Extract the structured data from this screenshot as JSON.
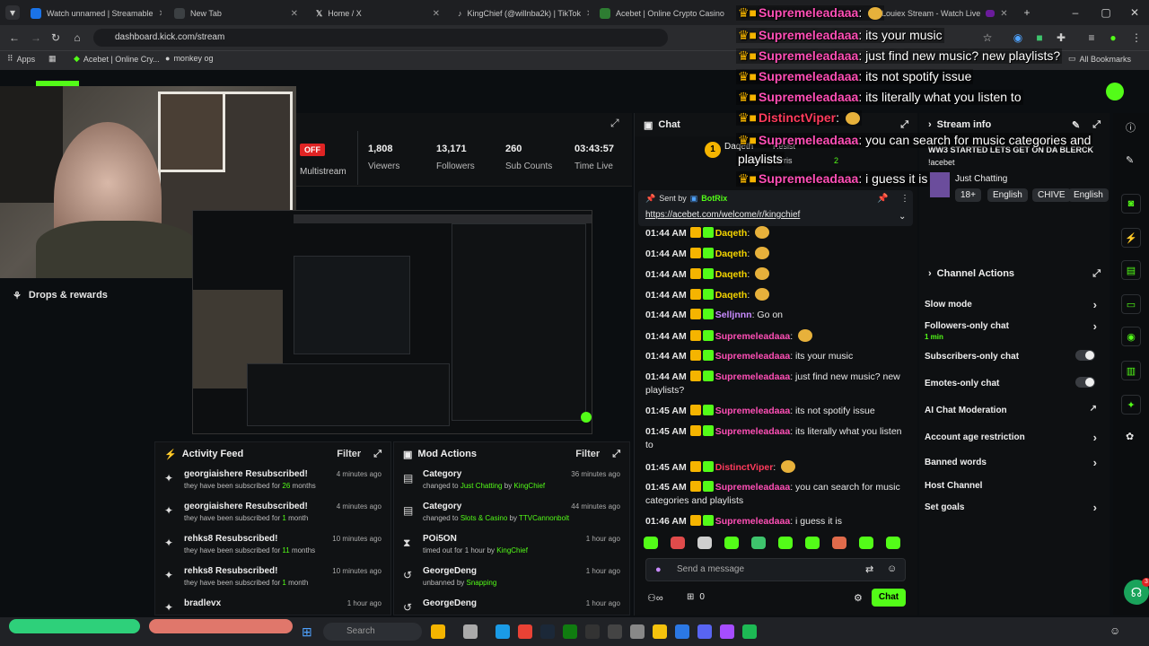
{
  "browser": {
    "tabs": [
      {
        "label": "Watch unnamed | Streamable",
        "color": "#1a73e8"
      },
      {
        "label": "New Tab",
        "color": "#3c4043"
      },
      {
        "label": "Home / X",
        "color": "#000000"
      },
      {
        "label": "KingChief (@willnba2k) | TikTok",
        "color": "#111111"
      },
      {
        "label": "Acebet | Online Crypto Casino",
        "color": "#2e7d32"
      },
      {
        "label": "Louiex Stream - Watch Live",
        "color": "#6a1b9a"
      }
    ],
    "url": "dashboard.kick.com/stream",
    "bookmarks": [
      "Apps",
      "Acebet | Online Cry...",
      "monkey og"
    ],
    "all_bookmarks": "All Bookmarks"
  },
  "left": {
    "drops_label": "Drops & rewards"
  },
  "stats": {
    "status": "OFF",
    "multistream": "Multistream",
    "items": [
      {
        "value": "1,808",
        "label": "Viewers"
      },
      {
        "value": "13,171",
        "label": "Followers"
      },
      {
        "value": "260",
        "label": "Sub Counts"
      },
      {
        "value": "03:43:57",
        "label": "Time Live"
      }
    ]
  },
  "activity": {
    "title": "Activity Feed",
    "filter": "Filter",
    "items": [
      {
        "name": "georgiaishere Resubscribed!",
        "pre": "they have been subscribed for ",
        "hl": "26",
        "post": " months",
        "time": "4 minutes ago"
      },
      {
        "name": "georgiaishere Resubscribed!",
        "pre": "they have been subscribed for ",
        "hl": "1",
        "post": " month",
        "time": "4 minutes ago"
      },
      {
        "name": "rehks8 Resubscribed!",
        "pre": "they have been subscribed for ",
        "hl": "11",
        "post": " months",
        "time": "10 minutes ago"
      },
      {
        "name": "rehks8 Resubscribed!",
        "pre": "they have been subscribed for ",
        "hl": "1",
        "post": " month",
        "time": "10 minutes ago"
      },
      {
        "name": "bradlevx",
        "pre": "",
        "hl": "",
        "post": "",
        "time": "1 hour ago"
      }
    ]
  },
  "mod": {
    "title": "Mod Actions",
    "filter": "Filter",
    "items": [
      {
        "name": "Category",
        "pre": "changed to ",
        "hl": "Just Chatting",
        "mid": " by ",
        "hl2": "KingChief",
        "time": "36 minutes ago"
      },
      {
        "name": "Category",
        "pre": "changed to ",
        "hl": "Slots & Casino",
        "mid": " by ",
        "hl2": "TTVCannonbolt",
        "time": "44 minutes ago"
      },
      {
        "name": "POi5ON",
        "pre": "timed out for 1 hour by ",
        "hl": "",
        "mid": "",
        "hl2": "KingChief",
        "time": "1 hour ago"
      },
      {
        "name": "GeorgeDeng",
        "pre": "unbanned by ",
        "hl": "",
        "mid": "",
        "hl2": "Snapping",
        "time": "1 hour ago"
      },
      {
        "name": "GeorgeDeng",
        "pre": "",
        "hl": "",
        "mid": "",
        "hl2": "",
        "time": "1 hour ago"
      }
    ]
  },
  "chat": {
    "title": "Chat",
    "pinned_by_prefix": "Sent by",
    "pinned_by": "BotRix",
    "pinned_link": "https://acebet.com/welcome/r/kingchief",
    "top_user": "Daqeth",
    "top_user2": "MathewHarris",
    "top_count": "2",
    "resist": "Resist",
    "messages": [
      {
        "time": "01:44 AM",
        "user": "Daqeth",
        "color": "#f5d400",
        "text": ""
      },
      {
        "time": "01:44 AM",
        "user": "Daqeth",
        "color": "#f5d400",
        "text": ""
      },
      {
        "time": "01:44 AM",
        "user": "Daqeth",
        "color": "#f5d400",
        "text": ""
      },
      {
        "time": "01:44 AM",
        "user": "Daqeth",
        "color": "#f5d400",
        "text": ""
      },
      {
        "time": "01:44 AM",
        "user": "Selljnnn",
        "color": "#c98bff",
        "text": "Go on"
      },
      {
        "time": "01:44 AM",
        "user": "Supremeleadaaa",
        "color": "#ff4fb6",
        "text": ""
      },
      {
        "time": "01:44 AM",
        "user": "Supremeleadaaa",
        "color": "#ff4fb6",
        "text": "its your music"
      },
      {
        "time": "01:44 AM",
        "user": "Supremeleadaaa",
        "color": "#ff4fb6",
        "text": "just find new music? new playlists?"
      },
      {
        "time": "01:45 AM",
        "user": "Supremeleadaaa",
        "color": "#ff4fb6",
        "text": "its not spotify issue"
      },
      {
        "time": "01:45 AM",
        "user": "Supremeleadaaa",
        "color": "#ff4fb6",
        "text": "its literally what you listen to"
      },
      {
        "time": "01:45 AM",
        "user": "DistinctViper",
        "color": "#ff3b5c",
        "text": ""
      },
      {
        "time": "01:45 AM",
        "user": "Supremeleadaaa",
        "color": "#ff4fb6",
        "text": "you can search for music categories and playlists"
      },
      {
        "time": "01:46 AM",
        "user": "Supremeleadaaa",
        "color": "#ff4fb6",
        "text": "i guess it is"
      }
    ],
    "input_placeholder": "Send a message",
    "footer_count": "0",
    "send_label": "Chat"
  },
  "overlay": {
    "lines": [
      {
        "user": "Supremeleadaaa",
        "text": ""
      },
      {
        "user": "Supremeleadaaa",
        "text": "its your music"
      },
      {
        "user": "Supremeleadaaa",
        "text": "just find new music? new playlists?"
      },
      {
        "user": "Supremeleadaaa",
        "text": "its not spotify issue"
      },
      {
        "user": "Supremeleadaaa",
        "text": "its literally what you listen to"
      },
      {
        "user": "DistinctViper",
        "text": ""
      },
      {
        "user": "Supremeleadaaa",
        "text": "you can search for music categories and"
      },
      {
        "user": "",
        "text": "playlists"
      },
      {
        "user": "Supremeleadaaa",
        "text": "i guess it is"
      }
    ]
  },
  "stream_info": {
    "title": "Stream info",
    "stream_title": "WW3 STARTED LETS GET ON DA BLERCK",
    "sub": "!acebet",
    "category": "Just Chatting",
    "tags": [
      "18+",
      "English",
      "CHIVE",
      "English"
    ]
  },
  "channel_actions": {
    "title": "Channel Actions",
    "items": [
      {
        "label": "Slow mode",
        "type": "chev",
        "sub": ""
      },
      {
        "label": "Followers-only chat",
        "type": "chev",
        "sub": "1 min"
      },
      {
        "label": "Subscribers-only chat",
        "type": "toggle",
        "sub": ""
      },
      {
        "label": "Emotes-only chat",
        "type": "toggle",
        "sub": ""
      },
      {
        "label": "AI Chat Moderation",
        "type": "ext",
        "sub": ""
      },
      {
        "label": "Account age restriction",
        "type": "chev",
        "sub": ""
      },
      {
        "label": "Banned words",
        "type": "chev",
        "sub": ""
      },
      {
        "label": "Host Channel",
        "type": "none",
        "sub": ""
      },
      {
        "label": "Set goals",
        "type": "chev",
        "sub": ""
      }
    ]
  },
  "taskbar": {
    "search": "Search",
    "notif_count": "3"
  }
}
